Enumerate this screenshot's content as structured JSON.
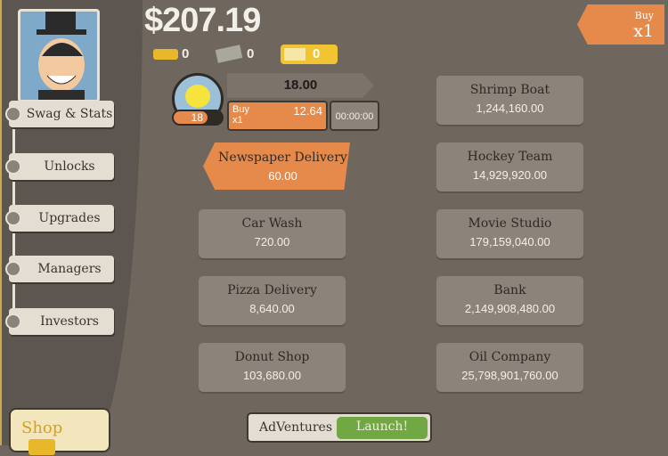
{
  "money": "$207.19",
  "currencies": {
    "gold": "0",
    "megabucks": "0",
    "tickets": "0"
  },
  "buy_multiplier": {
    "label": "Buy",
    "value": "x1"
  },
  "sidebar": {
    "items": [
      {
        "label": "Swag & Stats"
      },
      {
        "label": "Unlocks"
      },
      {
        "label": "Upgrades"
      },
      {
        "label": "Managers"
      },
      {
        "label": "Investors"
      }
    ],
    "shop": "Shop"
  },
  "lemonade": {
    "owned": "18",
    "revenue": "18.00",
    "buy_label": "Buy",
    "buy_mult": "x1",
    "cost": "12.64",
    "timer": "00:00:00"
  },
  "businesses": [
    {
      "name": "Newspaper Delivery",
      "cost": "60.00",
      "highlight": true
    },
    {
      "name": "Car Wash",
      "cost": "720.00"
    },
    {
      "name": "Pizza Delivery",
      "cost": "8,640.00"
    },
    {
      "name": "Donut Shop",
      "cost": "103,680.00"
    },
    {
      "name": "Shrimp Boat",
      "cost": "1,244,160.00"
    },
    {
      "name": "Hockey Team",
      "cost": "14,929,920.00"
    },
    {
      "name": "Movie Studio",
      "cost": "179,159,040.00"
    },
    {
      "name": "Bank",
      "cost": "2,149,908,480.00"
    },
    {
      "name": "Oil Company",
      "cost": "25,798,901,760.00"
    }
  ],
  "adventures": {
    "label": "AdVentures",
    "button": "Launch!"
  },
  "colors": {
    "accent": "#e58a4b",
    "card": "#8c837a",
    "launch": "#72a843"
  }
}
